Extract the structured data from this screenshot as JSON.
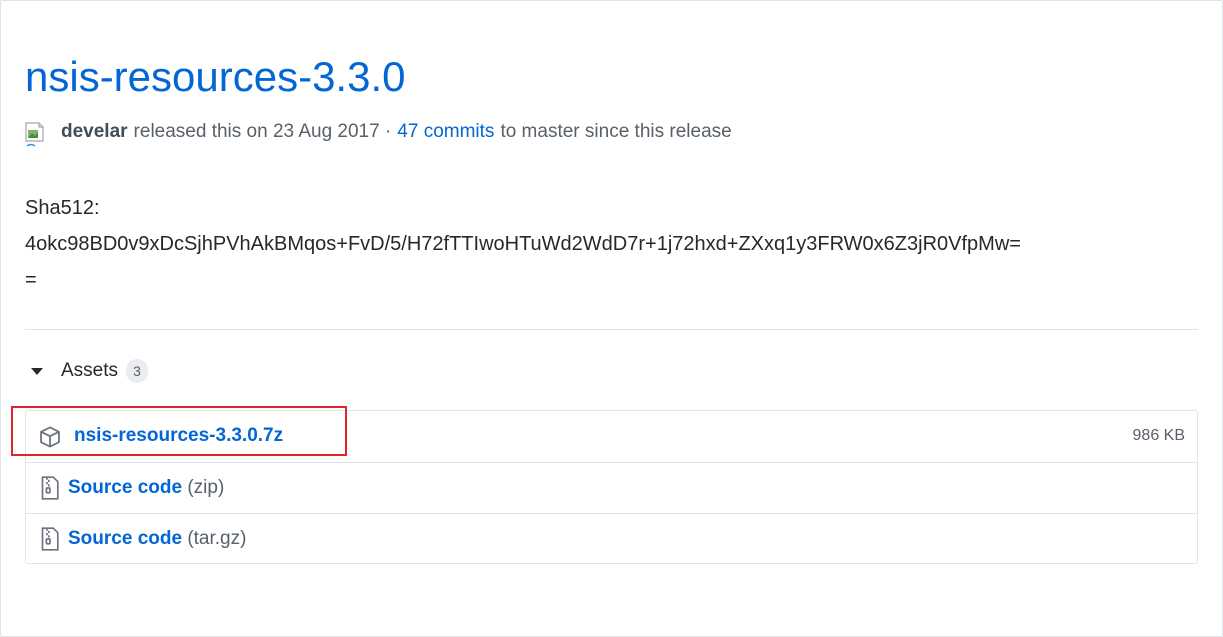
{
  "release": {
    "title": "nsis-resources-3.3.0",
    "author": "develar",
    "released_text": "released this on 23 Aug 2017 ·",
    "commits_link": "47 commits",
    "commits_suffix": "to master since this release"
  },
  "notes": {
    "label": "Sha512:",
    "hash": "4okc98BD0v9xDcSjhPVhAkBMqos+FvD/5/H72fTTIwoHTuWd2WdD7r+1j72hxd+ZXxq1y3FRW0x6Z3jR0VfpMw==",
    "hash_break": "4okc98BD0v9xDcSjhPVhAkBMqos+FvD/5/H72fTTIwoHTuWd2WdD7r+1j72hxd+ZXxq1y3FRW0x6Z3jR0VfpMw=",
    "hash_tail": "="
  },
  "assets": {
    "label": "Assets",
    "count": "3",
    "items": [
      {
        "name": "nsis-resources-3.3.0.7z",
        "size": "986 KB",
        "icon": "package-icon"
      },
      {
        "name": "Source code",
        "format": "(zip)",
        "icon": "file-zip-icon"
      },
      {
        "name": "Source code",
        "format": "(tar.gz)",
        "icon": "file-zip-icon"
      }
    ]
  },
  "colors": {
    "link": "#0366d6",
    "muted": "#586069",
    "highlight": "#e0242e"
  }
}
